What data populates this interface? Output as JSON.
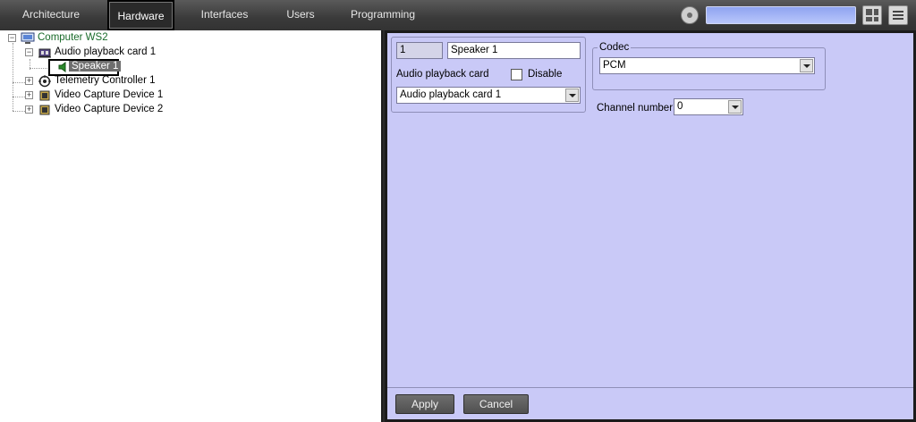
{
  "tabs": [
    {
      "label": "Architecture",
      "active": false
    },
    {
      "label": "Hardware",
      "active": true
    },
    {
      "label": "Interfaces",
      "active": false
    },
    {
      "label": "Users",
      "active": false
    },
    {
      "label": "Programming",
      "active": false
    }
  ],
  "toolbar": {
    "search_placeholder": "",
    "icons": [
      "gear-icon",
      "layout-icon",
      "menu-icon"
    ]
  },
  "tree": {
    "root": "Computer WS2",
    "audio_card": "Audio playback card 1",
    "speaker": "Speaker 1",
    "telemetry": "Telemetry Controller 1",
    "video1": "Video Capture Device 1",
    "video2": "Video Capture Device 2"
  },
  "form": {
    "id_value": "1",
    "name_value": "Speaker 1",
    "audio_card_label": "Audio playback card",
    "disable_label": "Disable",
    "disable_checked": false,
    "audio_card_value": "Audio playback card 1",
    "codec_label": "Codec",
    "codec_value": "PCM",
    "channel_label": "Channel number",
    "channel_value": "0"
  },
  "footer": {
    "apply_label": "Apply",
    "cancel_label": "Cancel"
  },
  "colors": {
    "panel_bg": "#c9c9f7",
    "root_text": "#1a6b2a",
    "selection_bg": "#6e6e6e"
  }
}
